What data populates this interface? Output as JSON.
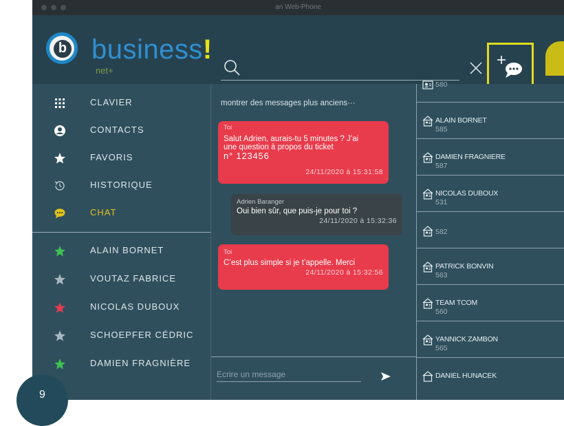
{
  "window": {
    "title": "an Web-Phone"
  },
  "header": {
    "logo_letter": "b",
    "brand_name": "business",
    "brand_excl": "!",
    "brand_sub": "net+"
  },
  "nav": [
    {
      "label": "CLAVIER",
      "icon": "keypad-icon",
      "active": false
    },
    {
      "label": "CONTACTS",
      "icon": "contacts-icon",
      "active": false
    },
    {
      "label": "FAVORIS",
      "icon": "star-icon",
      "active": false
    },
    {
      "label": "HISTORIQUE",
      "icon": "history-icon",
      "active": false
    },
    {
      "label": "CHAT",
      "icon": "chat-icon",
      "active": true
    }
  ],
  "favorites": [
    {
      "name": "ALAIN BORNET",
      "star_color": "#3fbf52"
    },
    {
      "name": "VOUTAZ FABRICE",
      "star_color": "#a9b6bc"
    },
    {
      "name": "NICOLAS DUBOUX",
      "star_color": "#e23b50"
    },
    {
      "name": "SCHOEPFER CÉDRIC",
      "star_color": "#a9b6bc"
    },
    {
      "name": "DAMIEN FRAGNIÈRE",
      "star_color": "#3fbf52"
    }
  ],
  "chat": {
    "older_link": "montrer des messages plus anciens···",
    "messages": [
      {
        "sender": "Toi",
        "text_lines": [
          "Salut Adrien, aurais-tu 5 minutes ? J’ai",
          "une question à propos du ticket",
          "n° 123456"
        ],
        "time": "24/11/2020 à 15:31:58",
        "mine": true
      },
      {
        "sender": "Adrien Baranger",
        "text_lines": [
          "Oui bien sûr, que puis-je pour toi ?"
        ],
        "time": "24/11/2020 à 15:32:36",
        "mine": false
      },
      {
        "sender": "Toi",
        "text_lines": [
          "C’est plus simple si je t’appelle. Merci"
        ],
        "time": "24/11/2020 à 15:32:56",
        "mine": true
      }
    ],
    "input_placeholder": "Ecrire un message"
  },
  "contacts": [
    {
      "name": "",
      "number": "580"
    },
    {
      "name": "ALAIN BORNET",
      "number": "585"
    },
    {
      "name": "DAMIEN FRAGNIERE",
      "number": "587"
    },
    {
      "name": "NICOLAS DUBOUX",
      "number": "531"
    },
    {
      "name": "",
      "number": "582"
    },
    {
      "name": "PATRICK BONVIN",
      "number": "563"
    },
    {
      "name": "TEAM TCOM",
      "number": "560"
    },
    {
      "name": "YANNICK ZAMBON",
      "number": "565"
    },
    {
      "name": "DANIEL HUNACEK",
      "number": ""
    }
  ],
  "step_badge": "9",
  "colors": {
    "accent": "#e2c31b",
    "mine_bubble": "#e83b4b",
    "theirs_bubble": "#3a4347",
    "highlight": "#e2dc23"
  }
}
